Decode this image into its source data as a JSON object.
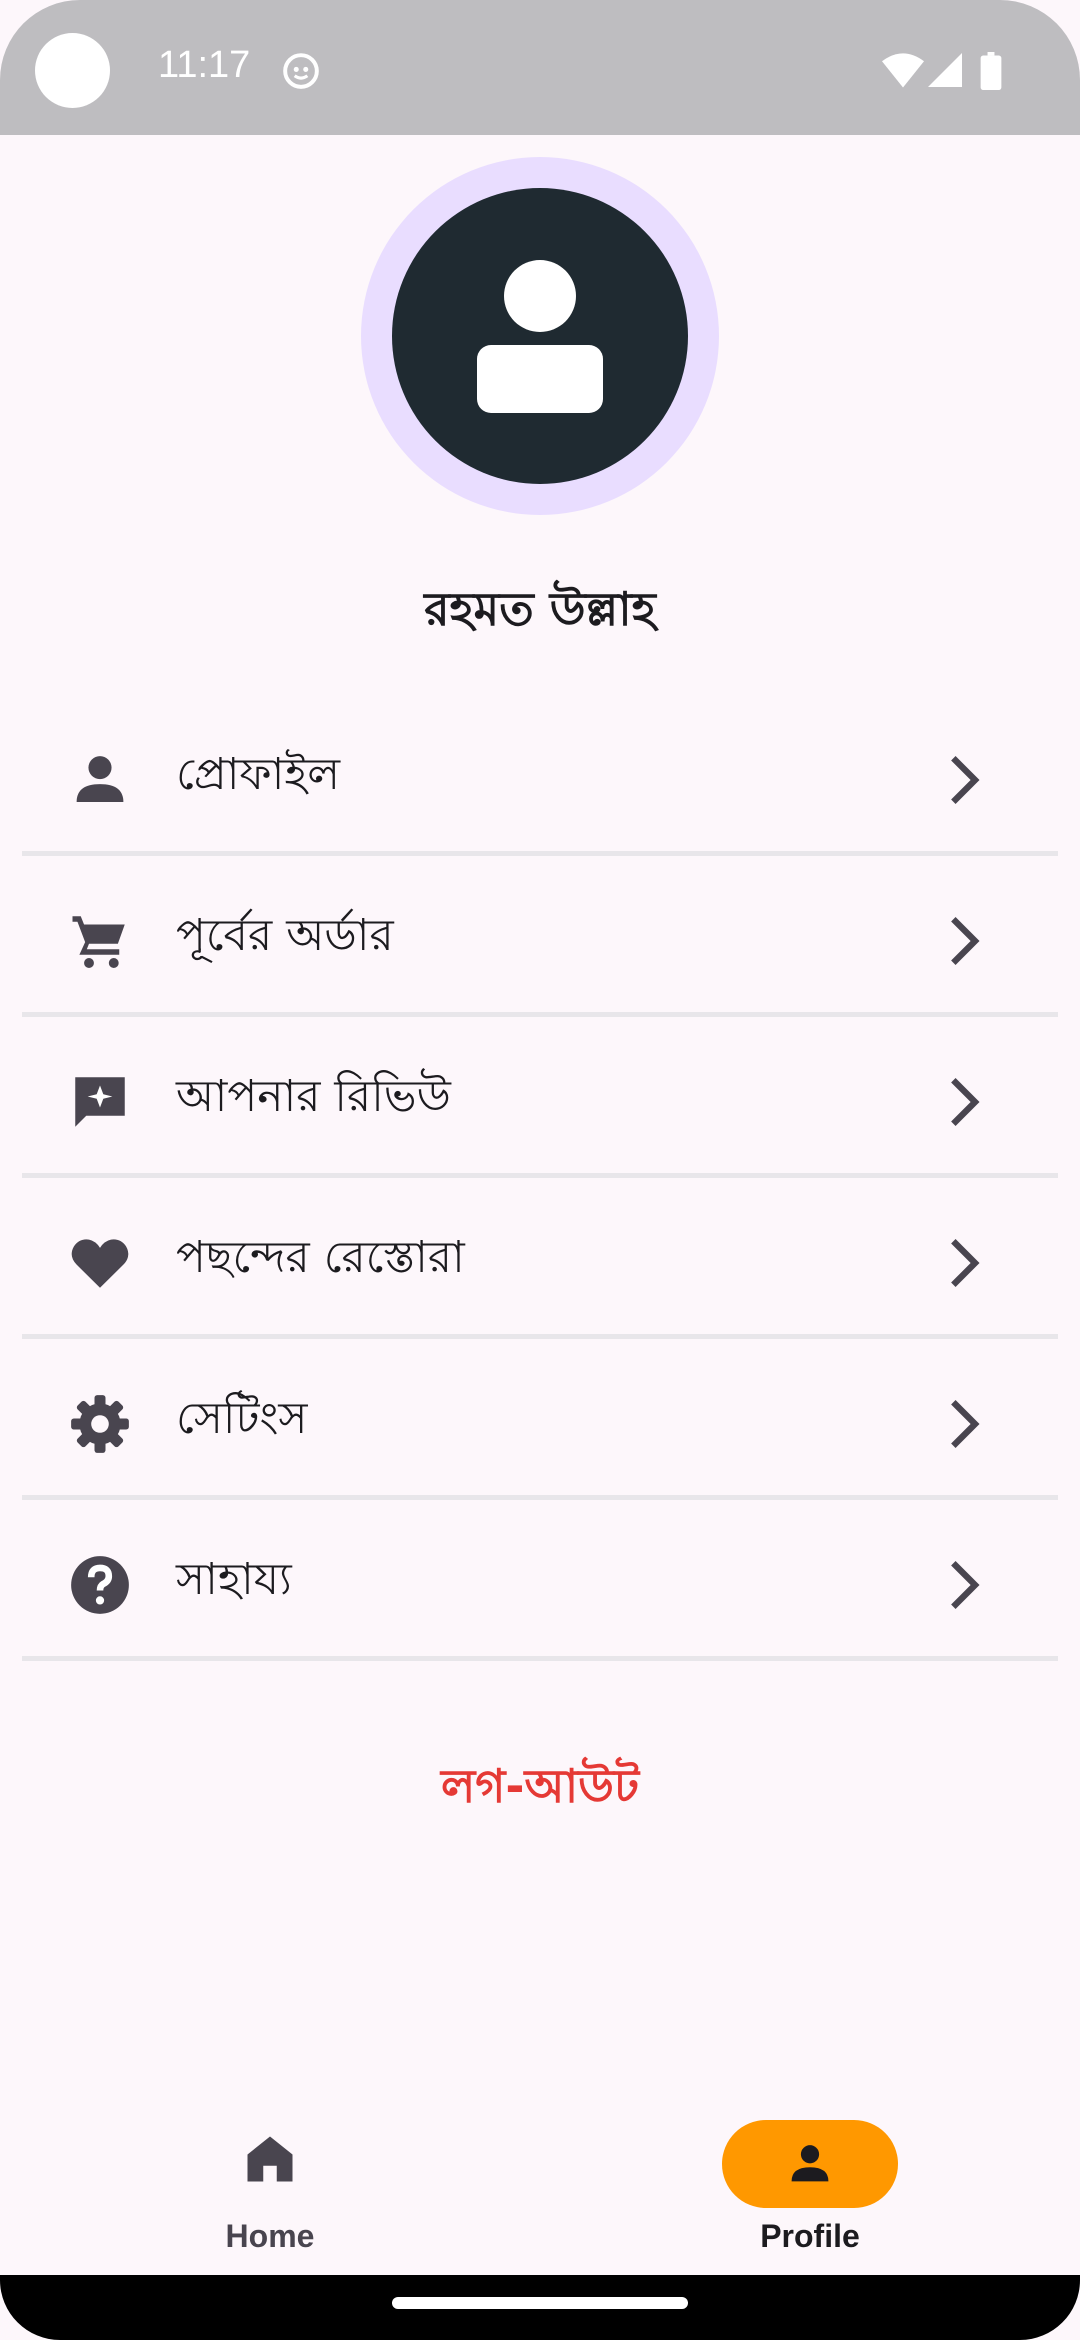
{
  "status_bar": {
    "time": "11:17"
  },
  "profile": {
    "name": "রহমত উল্লাহ"
  },
  "menu": {
    "items": [
      {
        "label": "প্রোফাইল",
        "icon": "person-icon"
      },
      {
        "label": "পূর্বের অর্ডার",
        "icon": "cart-icon"
      },
      {
        "label": "আপনার রিভিউ",
        "icon": "review-icon"
      },
      {
        "label": "পছন্দের রেস্তোরা",
        "icon": "heart-icon"
      },
      {
        "label": "সেটিংস",
        "icon": "gear-icon"
      },
      {
        "label": "সাহায্য",
        "icon": "help-icon"
      }
    ]
  },
  "logout_label": "লগ-আউট",
  "bottom_nav": {
    "home_label": "Home",
    "profile_label": "Profile",
    "active": "Profile"
  },
  "colors": {
    "background": "#fdf7fb",
    "avatar_ring": "#e9ddff",
    "avatar_fill": "#1f2a31",
    "logout": "#e53935",
    "nav_active_pill": "#ff9800",
    "icon": "#49454f"
  }
}
